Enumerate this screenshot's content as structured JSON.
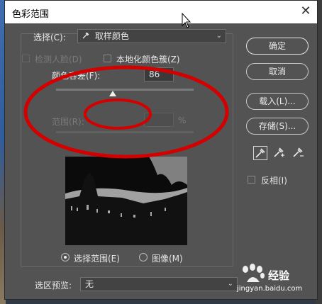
{
  "dialog": {
    "title": "色彩范围",
    "close_glyph": "✕"
  },
  "select": {
    "label": "选择(C):",
    "value": "取样颜色",
    "value_icon": "eyedropper-icon"
  },
  "detect_faces": {
    "label": "检测人脸(D)",
    "checked": false,
    "enabled": false
  },
  "localized_clusters": {
    "label": "本地化颜色簇(Z)",
    "checked": false
  },
  "fuzziness": {
    "label": "颜色容差(F):",
    "value": "86",
    "slider_fraction": 0.41
  },
  "range": {
    "label": "范围(R):",
    "unit": "%",
    "value": "",
    "enabled": false
  },
  "preview_mode": {
    "options": [
      {
        "label": "选择范围(E)",
        "selected": true
      },
      {
        "label": "图像(M)",
        "selected": false
      }
    ]
  },
  "selection_preview": {
    "label": "选区预览:",
    "value": "无"
  },
  "buttons": {
    "ok": "确定",
    "cancel": "取消",
    "load": "载入(L)...",
    "save": "存储(S)..."
  },
  "eyedroppers": [
    "eyedropper-icon",
    "eyedropper-plus-icon",
    "eyedropper-minus-icon"
  ],
  "invert": {
    "label": "反相(I)",
    "checked": false
  },
  "annotation_color": "#d40000",
  "watermark": {
    "brand": "经验",
    "url": "jingyan.baidu.com"
  }
}
